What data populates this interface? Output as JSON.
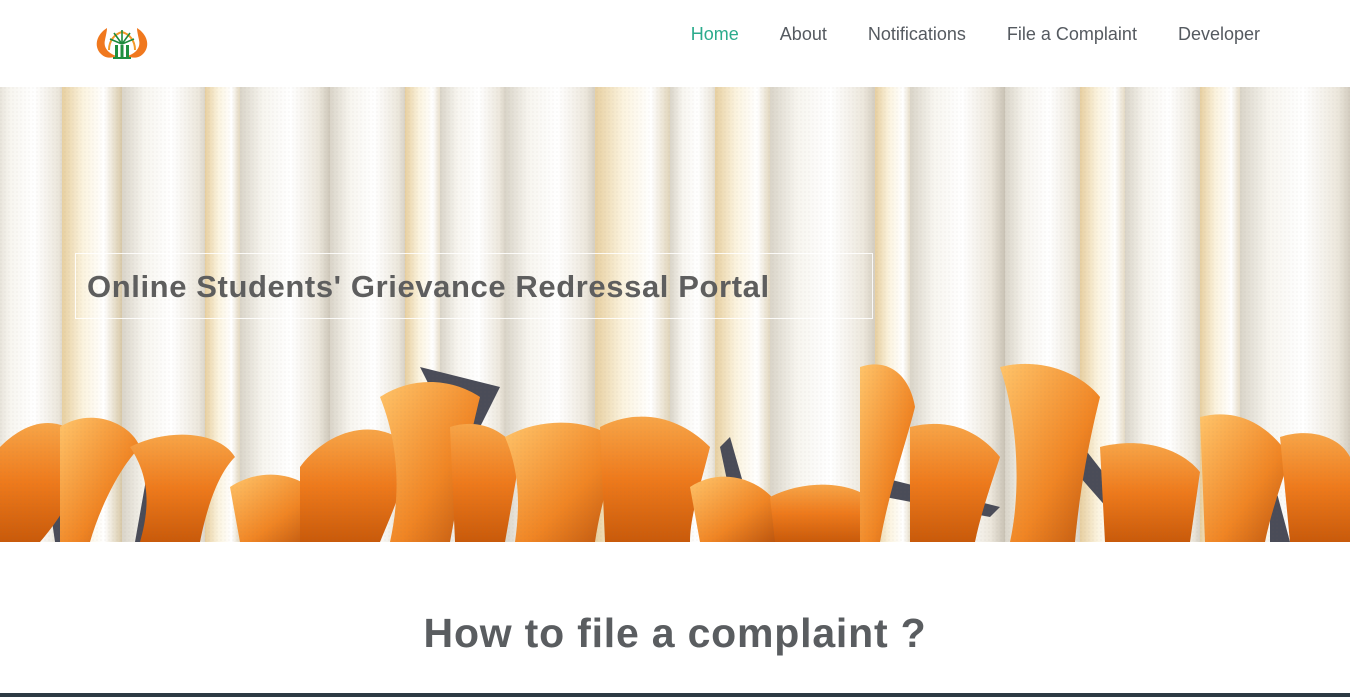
{
  "header": {
    "logo_icon": "institution-emblem-icon",
    "nav": {
      "items": [
        {
          "label": "Home",
          "active": true
        },
        {
          "label": "About",
          "active": false
        },
        {
          "label": "Notifications",
          "active": false
        },
        {
          "label": "File a Complaint",
          "active": false
        },
        {
          "label": "Developer",
          "active": false
        }
      ]
    },
    "active_color": "#2bab8c",
    "text_color": "#555a60"
  },
  "hero": {
    "title": "Online Students' Grievance Redressal Portal",
    "image": "graduation-diploma-scrolls-with-orange-ribbons"
  },
  "section": {
    "heading": "How to file a complaint ?"
  }
}
